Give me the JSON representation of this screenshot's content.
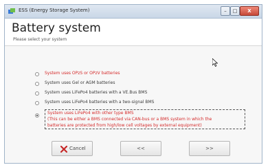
{
  "window": {
    "title": "ESS (Energy Storage System)",
    "controls": {
      "min": "–",
      "max": "□",
      "close": "X"
    }
  },
  "header": {
    "title": "Battery system",
    "subtitle": "Please select your system"
  },
  "options": [
    {
      "label": "System uses OPzS or OPzV batteries",
      "color": "#d42a2a",
      "checked": false
    },
    {
      "label": "System uses Gel or AGM batteries",
      "color": "#3a3a3a",
      "checked": false
    },
    {
      "label": "System uses LiFePo4 batteries with a VE.Bus BMS",
      "color": "#3a3a3a",
      "checked": false
    },
    {
      "label": "System uses LiFePo4 batteries with a two-signal BMS",
      "color": "#3a3a3a",
      "checked": false
    }
  ],
  "selected_option": {
    "lines": [
      "System uses LiFePo4 with other type BMS",
      "(This can be either a BMS connected via CAN-bus or a BMS system in which the",
      "batteries are protected from high/low cell voltages by external equipment)"
    ],
    "color": "#d42a2a",
    "checked": true
  },
  "buttons": {
    "cancel": "Cancel",
    "back": "<<",
    "next": ">>"
  },
  "colors": {
    "accent_red": "#d42a2a",
    "cancel_icon": "#c62828"
  }
}
